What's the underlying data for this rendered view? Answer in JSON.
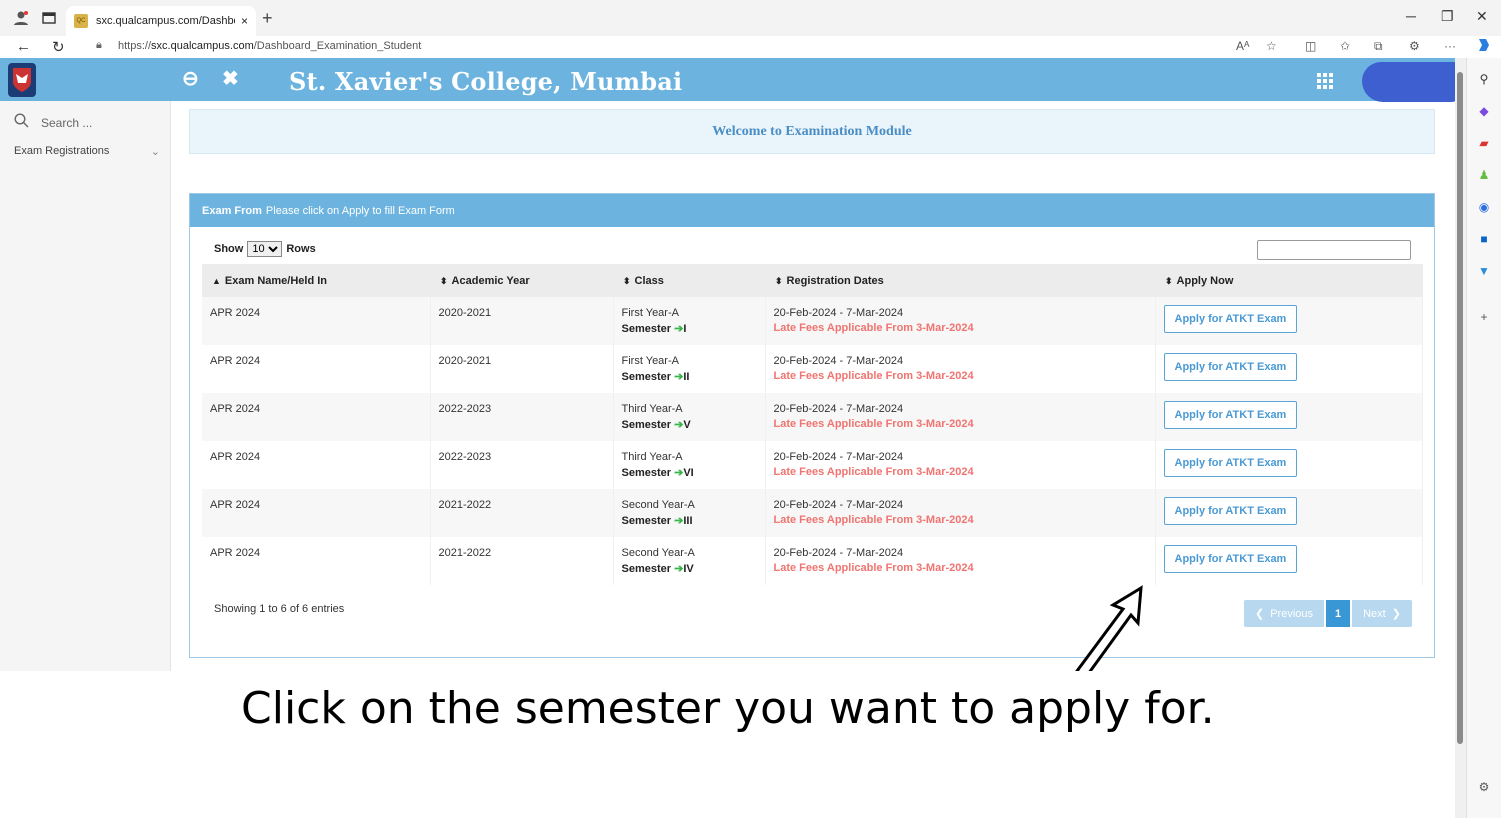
{
  "browser": {
    "tab_title": "sxc.qualcampus.com/Dashboard_",
    "tab_close": "×",
    "new_tab": "+",
    "url_prefix": "https://",
    "url_host": "sxc.qualcampus.com",
    "url_path": "/Dashboard_Examination_Student",
    "read_aloud": "Aͅ",
    "more": "···"
  },
  "header": {
    "college_name": "St. Xavier's College, Mumbai"
  },
  "sidebar": {
    "search_placeholder": "Search ...",
    "menu_item": "Exam Registrations"
  },
  "welcome": "Welcome to Examination Module",
  "panel": {
    "title_bold": "Exam From",
    "title_rest": "Please click on Apply to fill Exam Form",
    "show_label": "Show",
    "rows_label": "Rows",
    "rows_value": "10",
    "showing": "Showing 1 to 6 of 6 entries",
    "prev": "Previous",
    "current_page": "1",
    "next": "Next"
  },
  "table": {
    "headers": [
      "Exam Name/Held In",
      "Academic Year",
      "Class",
      "Registration Dates",
      "Apply Now"
    ],
    "semester_label": "Semester",
    "late_text": "Late Fees Applicable From 3-Mar-2024",
    "apply_label": "Apply for ATKT Exam",
    "rows": [
      {
        "exam": "APR 2024",
        "year": "2020-2021",
        "class": "First Year-A",
        "sem": "I",
        "dates": "20-Feb-2024 - 7-Mar-2024"
      },
      {
        "exam": "APR 2024",
        "year": "2020-2021",
        "class": "First Year-A",
        "sem": "II",
        "dates": "20-Feb-2024 - 7-Mar-2024"
      },
      {
        "exam": "APR 2024",
        "year": "2022-2023",
        "class": "Third Year-A",
        "sem": "V",
        "dates": "20-Feb-2024 - 7-Mar-2024"
      },
      {
        "exam": "APR 2024",
        "year": "2022-2023",
        "class": "Third Year-A",
        "sem": "VI",
        "dates": "20-Feb-2024 - 7-Mar-2024"
      },
      {
        "exam": "APR 2024",
        "year": "2021-2022",
        "class": "Second Year-A",
        "sem": "III",
        "dates": "20-Feb-2024 - 7-Mar-2024"
      },
      {
        "exam": "APR 2024",
        "year": "2021-2022",
        "class": "Second Year-A",
        "sem": "IV",
        "dates": "20-Feb-2024 - 7-Mar-2024"
      }
    ]
  },
  "caption": "Click on the semester you want to apply for.",
  "colors": {
    "header_blue": "#6cb4df",
    "late_red": "#f07470",
    "arrow_green": "#3bb54a"
  }
}
